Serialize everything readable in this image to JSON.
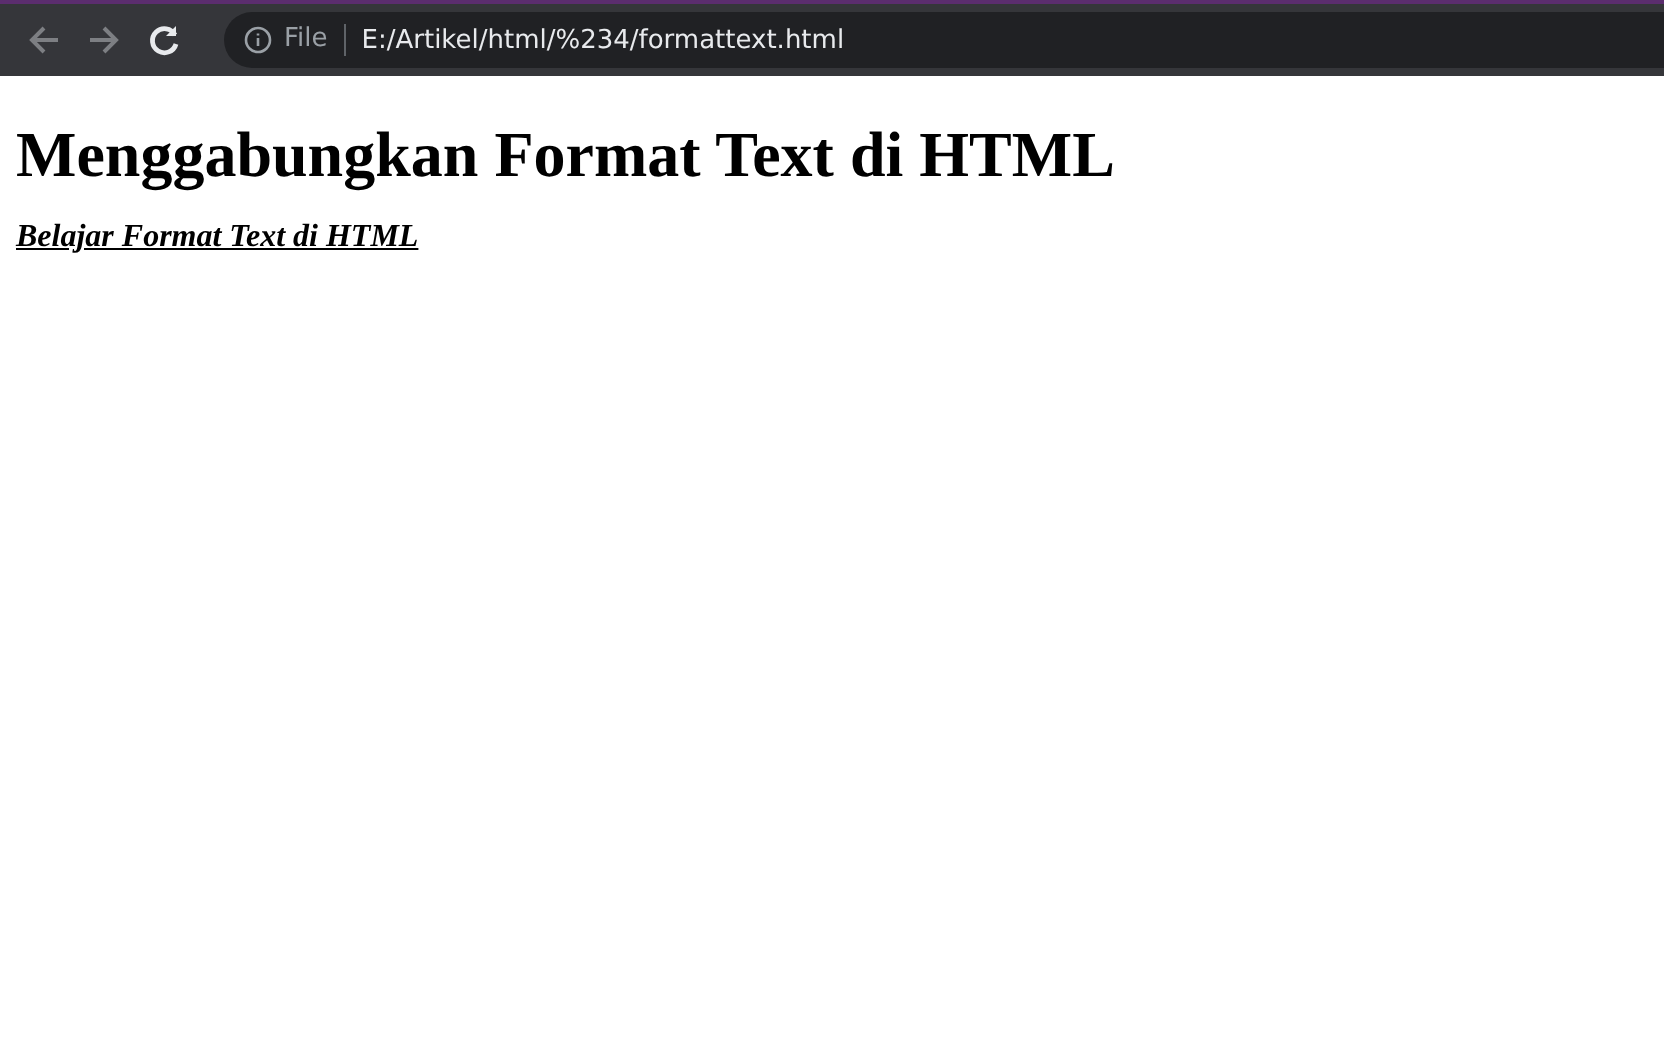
{
  "toolbar": {
    "back": {
      "disabled": true
    },
    "forward": {
      "disabled": true
    },
    "scheme": "File",
    "url": "E:/Artikel/html/%234/formattext.html"
  },
  "page": {
    "heading": "Menggabungkan Format Text di HTML",
    "subtitle": "Belajar Format Text di HTML"
  }
}
